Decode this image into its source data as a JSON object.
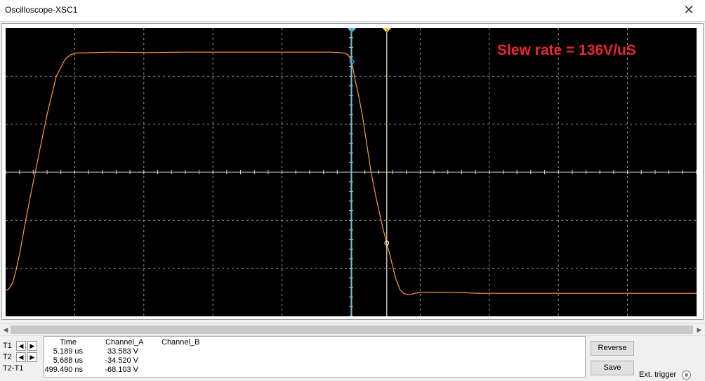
{
  "window": {
    "title": "Oscilloscope-XSC1",
    "close_glyph": "✕"
  },
  "annotation": {
    "text": "Slew rate = 136V/uS",
    "color": "#e8282e"
  },
  "scope": {
    "background": "#000000",
    "trace_color": "#ff9a3c",
    "cursor1_color": "#38a8d8",
    "cursor2_color": "#f2efc8",
    "cursor1_marker": "1",
    "cursor2_marker": "2"
  },
  "chart_data": {
    "type": "line",
    "grid": true,
    "xlim": [
      0,
      10
    ],
    "ylim": [
      -3,
      3
    ],
    "series": [
      {
        "x": [
          0.0,
          0.06,
          0.12,
          0.2,
          0.28,
          0.4,
          0.55,
          0.72,
          0.85,
          1.0,
          1.2,
          1.45,
          1.7,
          1.85,
          2.0,
          3.0,
          4.0,
          5.0,
          6.0,
          7.0,
          8.0,
          8.5,
          9.0,
          9.3,
          9.55,
          9.7,
          9.8,
          9.9,
          10.0,
          10.08,
          10.2,
          10.45,
          10.6,
          10.8,
          11.0,
          11.15,
          11.28,
          11.4,
          11.55,
          11.7,
          11.9,
          12.3,
          12.8,
          13.5,
          15.0,
          17.0,
          19.0,
          19.76
        ],
        "y": [
          -2.45,
          -2.45,
          -2.4,
          -2.3,
          -2.1,
          -1.7,
          -1.1,
          -0.45,
          0.0,
          0.55,
          1.25,
          2.0,
          2.35,
          2.44,
          2.48,
          2.5,
          2.49,
          2.5,
          2.5,
          2.5,
          2.5,
          2.5,
          2.5,
          2.5,
          2.49,
          2.48,
          2.44,
          2.3,
          1.9,
          1.65,
          1.2,
          0.0,
          -0.55,
          -1.2,
          -1.75,
          -2.2,
          -2.45,
          -2.53,
          -2.55,
          -2.52,
          -2.5,
          -2.5,
          -2.5,
          -2.52,
          -2.52,
          -2.52,
          -2.52,
          -2.52
        ]
      }
    ],
    "cursors": [
      {
        "name": "1",
        "x": 9.9
      },
      {
        "name": "2",
        "x": 10.9
      }
    ]
  },
  "cursor_rows": [
    {
      "label": "T1",
      "left": "◀",
      "right": "▶"
    },
    {
      "label": "T2",
      "left": "◀",
      "right": "▶"
    },
    {
      "label": "T2-T1"
    }
  ],
  "readout": {
    "headers": {
      "time": "Time",
      "channel_a": "Channel_A",
      "channel_b": "Channel_B"
    },
    "rows": [
      {
        "time": "5.189 us",
        "channel_a": "33.583 V",
        "channel_b": ""
      },
      {
        "time": "5.688 us",
        "channel_a": "-34.520 V",
        "channel_b": ""
      },
      {
        "time": "499.490 ns",
        "channel_a": "-68.103 V",
        "channel_b": ""
      }
    ]
  },
  "buttons": {
    "reverse": "Reverse",
    "save": "Save"
  },
  "ext_trigger_label": "Ext. trigger",
  "scrollbar": {
    "left_arrow": "◀",
    "right_arrow": "▶"
  }
}
